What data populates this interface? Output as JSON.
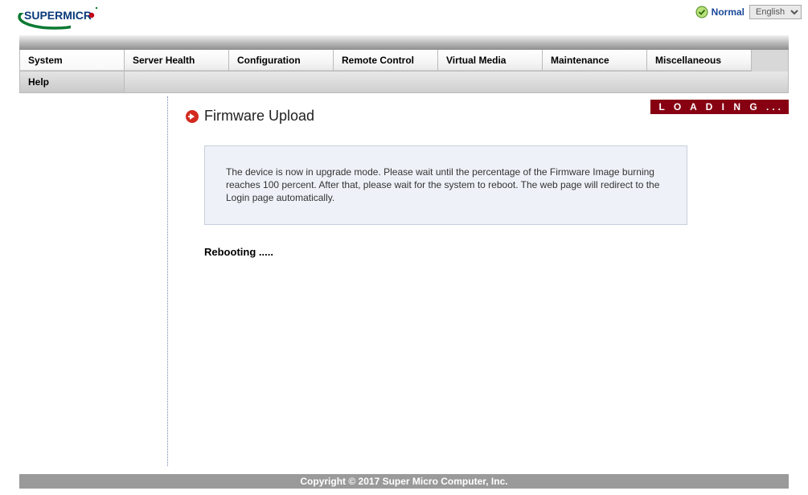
{
  "header": {
    "status": {
      "label": "Normal"
    },
    "language": {
      "selected": "English",
      "options": [
        "English"
      ]
    }
  },
  "nav": {
    "row1": [
      {
        "label": "System"
      },
      {
        "label": "Server Health"
      },
      {
        "label": "Configuration"
      },
      {
        "label": "Remote Control"
      },
      {
        "label": "Virtual Media"
      },
      {
        "label": "Maintenance"
      },
      {
        "label": "Miscellaneous"
      }
    ],
    "row2": [
      {
        "label": "Help"
      }
    ]
  },
  "loading": {
    "text": "L O A D I N G ..."
  },
  "page": {
    "title": "Firmware Upload",
    "info": "The device is now in upgrade mode. Please wait until the percentage of the Firmware Image burning reaches 100 percent. After that, please wait for the system to reboot. The web page will redirect to the Login page automatically.",
    "reboot": "Rebooting ....."
  },
  "footer": {
    "text": "Copyright © 2017 Super Micro Computer, Inc."
  }
}
